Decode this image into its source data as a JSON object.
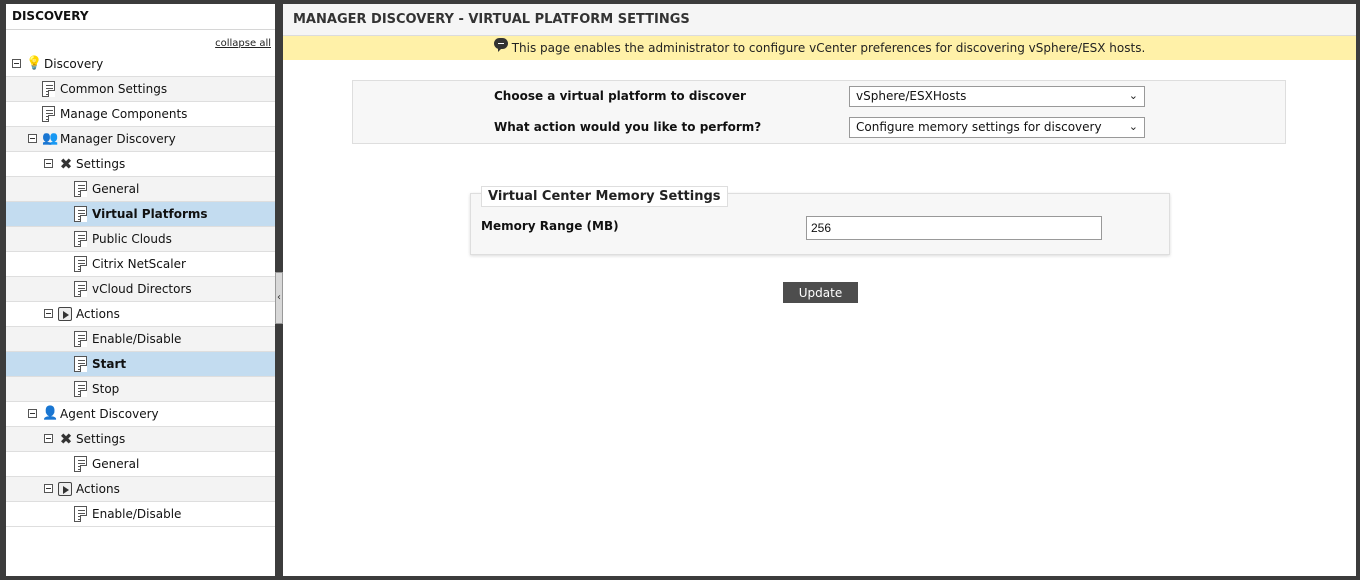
{
  "left_panel": {
    "title": "DISCOVERY",
    "collapse_all": "collapse all",
    "tree": [
      {
        "label": "Discovery",
        "level": 0,
        "icon": "lightbulb-icon",
        "toggle": true,
        "style": "white"
      },
      {
        "label": "Common Settings",
        "level": 1,
        "icon": "page-icon",
        "toggle": false,
        "style": "grey"
      },
      {
        "label": "Manage Components",
        "level": 1,
        "icon": "page-icon",
        "toggle": false,
        "style": "white"
      },
      {
        "label": "Manager Discovery",
        "level": 1,
        "icon": "manager-icon",
        "toggle": true,
        "style": "grey"
      },
      {
        "label": "Settings",
        "level": 2,
        "icon": "tools-icon",
        "toggle": true,
        "style": "white"
      },
      {
        "label": "General",
        "level": 3,
        "icon": "page-icon",
        "toggle": false,
        "style": "grey"
      },
      {
        "label": "Virtual Platforms",
        "level": 3,
        "icon": "page-icon",
        "toggle": false,
        "style": "selected"
      },
      {
        "label": "Public Clouds",
        "level": 3,
        "icon": "page-icon",
        "toggle": false,
        "style": "grey"
      },
      {
        "label": "Citrix NetScaler",
        "level": 3,
        "icon": "page-icon",
        "toggle": false,
        "style": "white"
      },
      {
        "label": "vCloud Directors",
        "level": 3,
        "icon": "page-icon",
        "toggle": false,
        "style": "grey"
      },
      {
        "label": "Actions",
        "level": 2,
        "icon": "action-icon",
        "toggle": true,
        "style": "white"
      },
      {
        "label": "Enable/Disable",
        "level": 3,
        "icon": "page-icon",
        "toggle": false,
        "style": "grey"
      },
      {
        "label": "Start",
        "level": 3,
        "icon": "page-icon",
        "toggle": false,
        "style": "selected"
      },
      {
        "label": "Stop",
        "level": 3,
        "icon": "page-icon",
        "toggle": false,
        "style": "grey"
      },
      {
        "label": "Agent Discovery",
        "level": 1,
        "icon": "agent-icon",
        "toggle": true,
        "style": "white"
      },
      {
        "label": "Settings",
        "level": 2,
        "icon": "tools-icon",
        "toggle": true,
        "style": "grey"
      },
      {
        "label": "General",
        "level": 3,
        "icon": "page-icon",
        "toggle": false,
        "style": "white"
      },
      {
        "label": "Actions",
        "level": 2,
        "icon": "action-icon",
        "toggle": true,
        "style": "grey"
      },
      {
        "label": "Enable/Disable",
        "level": 3,
        "icon": "page-icon",
        "toggle": false,
        "style": "white"
      }
    ]
  },
  "main": {
    "title": "MANAGER DISCOVERY - VIRTUAL PLATFORM SETTINGS",
    "info": "This page enables the administrator to configure vCenter preferences for discovering vSphere/ESX hosts.",
    "platform_label": "Choose a virtual platform to discover",
    "platform_value": "vSphere/ESXHosts",
    "action_label": "What action would you like to perform?",
    "action_value": "Configure memory settings for discovery",
    "memory": {
      "legend": "Virtual Center Memory Settings",
      "range_label": "Memory Range (MB)",
      "range_value": "256"
    },
    "update_label": "Update"
  },
  "colors": {
    "selected_row": "#c3dcf0",
    "info_bar": "#fff1a8",
    "button": "#4d4d4d"
  }
}
